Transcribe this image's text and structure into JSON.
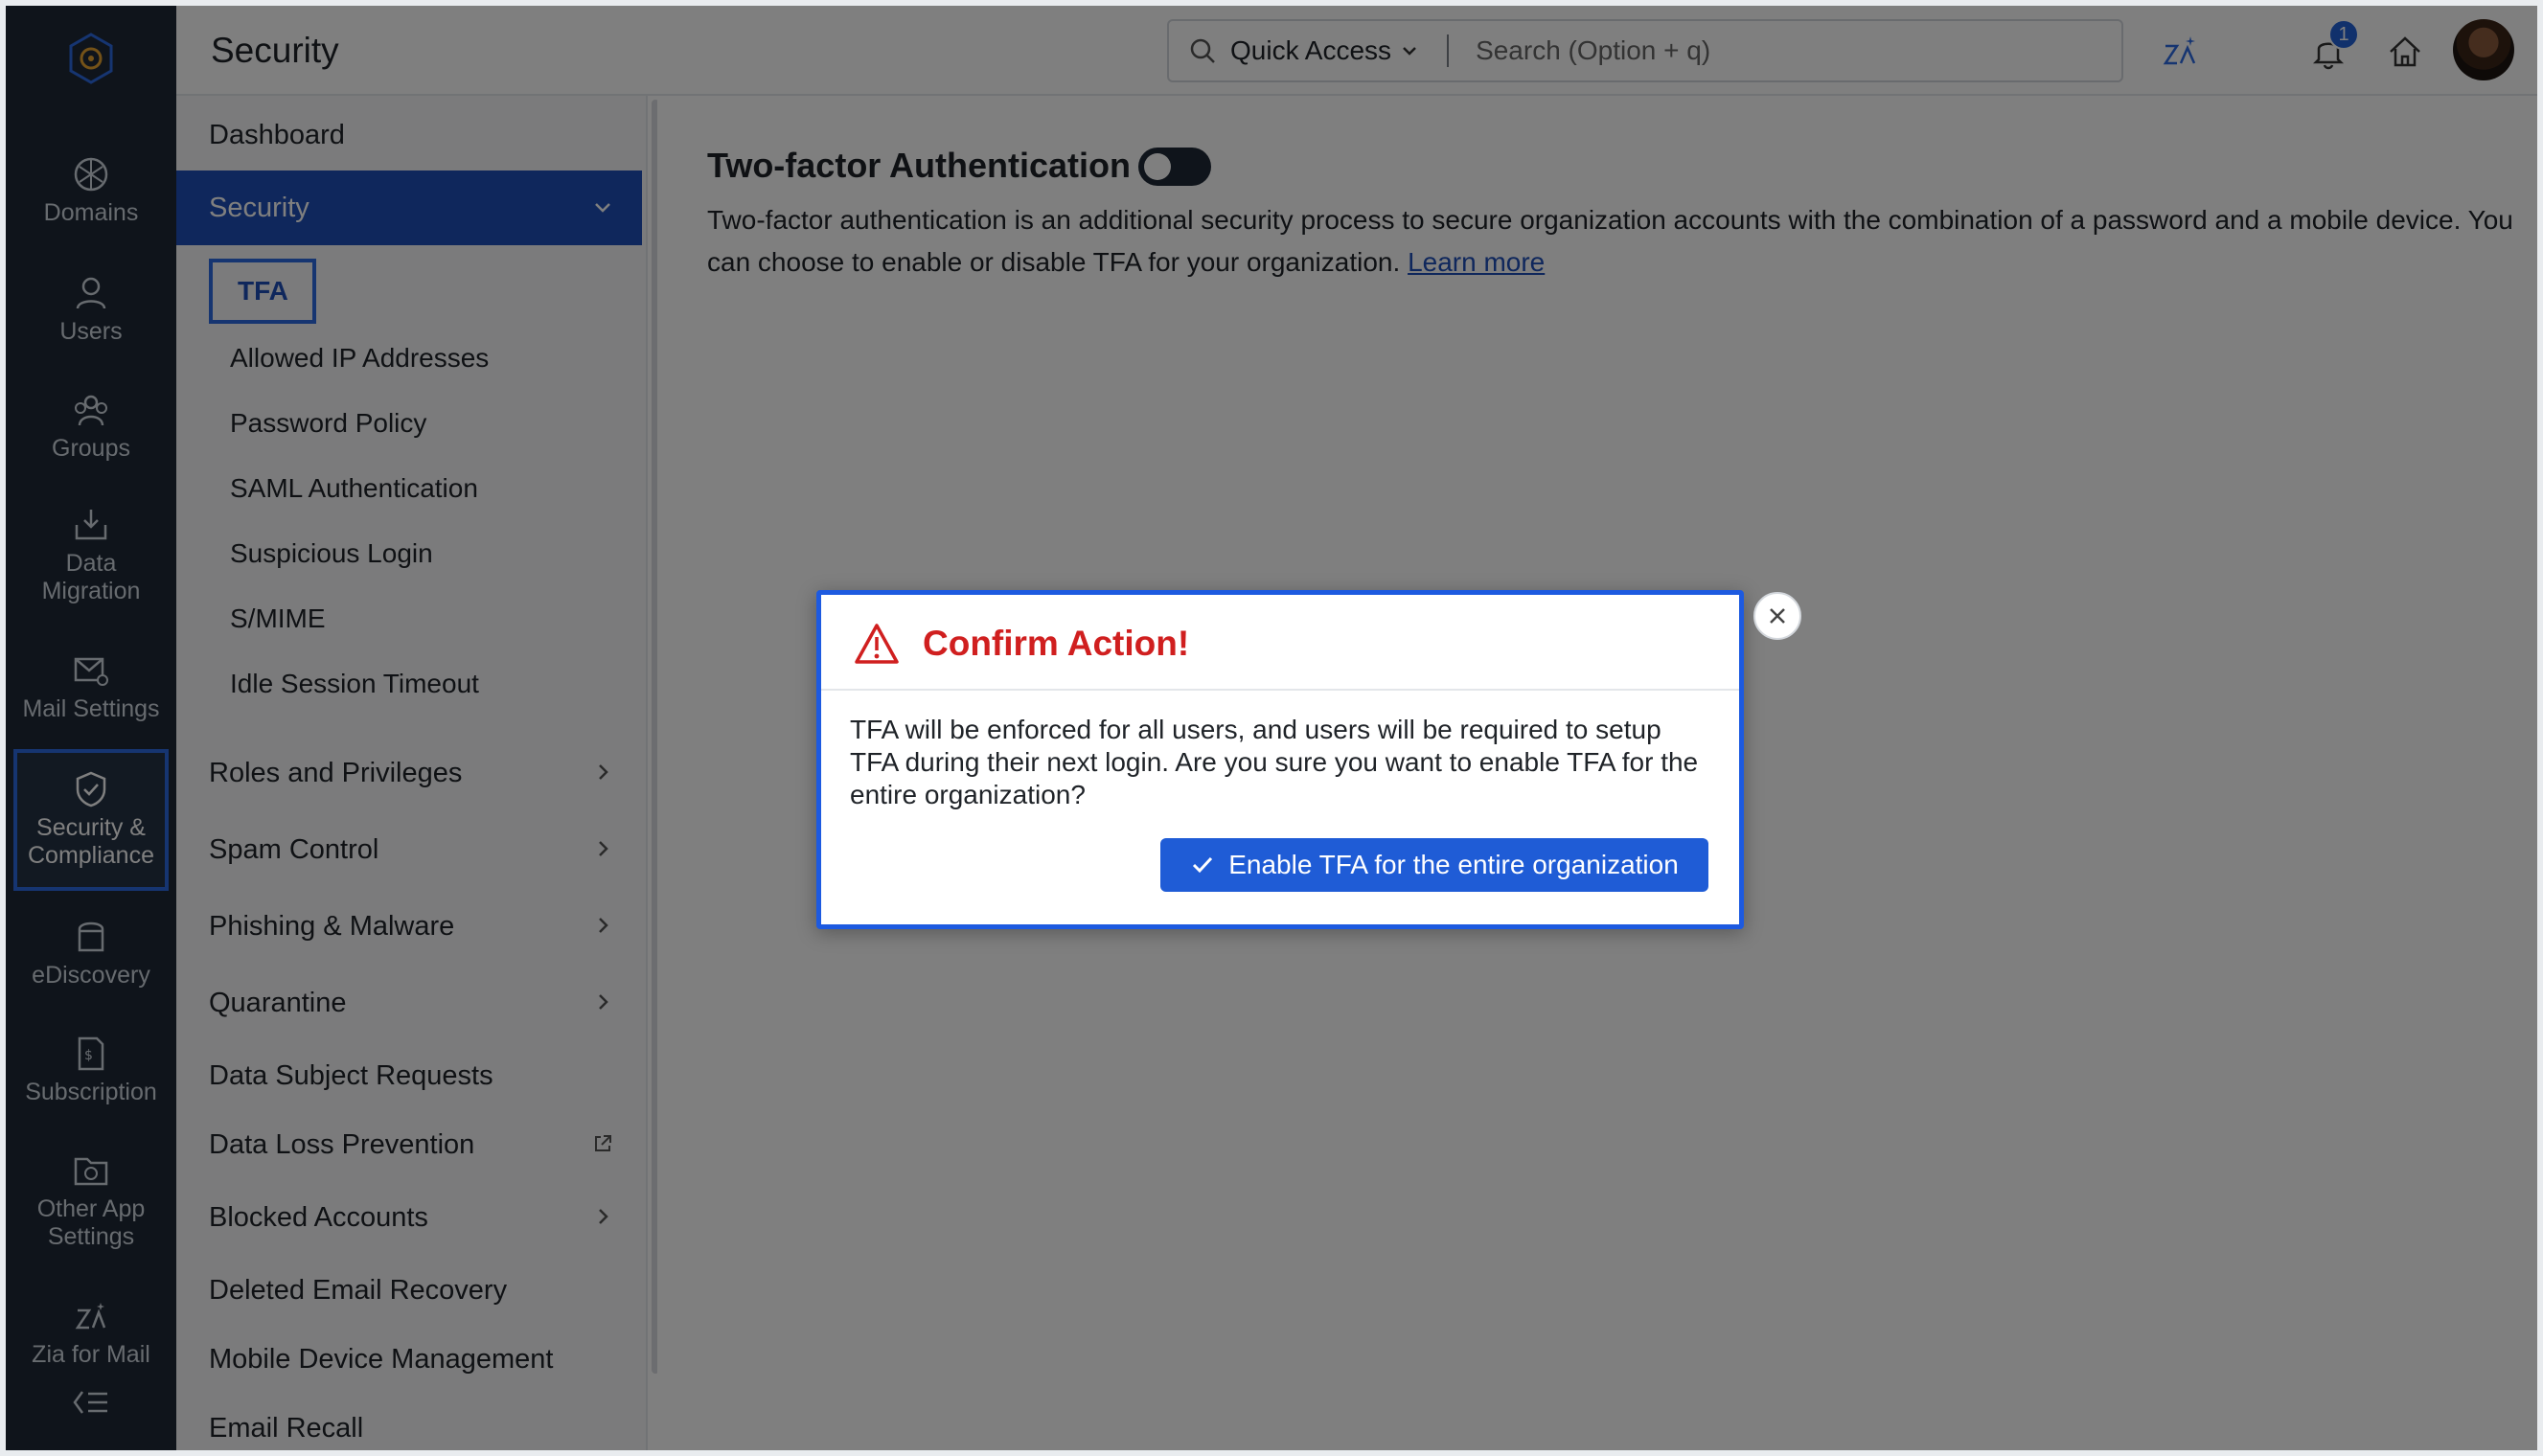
{
  "header": {
    "title": "Security",
    "quick_access_label": "Quick Access",
    "search_placeholder": "Search (Option + q)",
    "notification_count": "1"
  },
  "rail": {
    "items": [
      {
        "label": "Domains"
      },
      {
        "label": "Users"
      },
      {
        "label": "Groups"
      },
      {
        "label": "Data Migration"
      },
      {
        "label": "Mail Settings"
      },
      {
        "label": "Security & Compliance"
      },
      {
        "label": "eDiscovery"
      },
      {
        "label": "Subscription"
      },
      {
        "label": "Other App Settings"
      },
      {
        "label": "Zia for Mail"
      }
    ]
  },
  "subnav": {
    "dashboard": "Dashboard",
    "security": "Security",
    "security_children": [
      "TFA",
      "Allowed IP Addresses",
      "Password Policy",
      "SAML Authentication",
      "Suspicious Login",
      "S/MIME",
      "Idle Session Timeout"
    ],
    "items": [
      "Roles and Privileges",
      "Spam Control",
      "Phishing & Malware",
      "Quarantine",
      "Data Subject Requests",
      "Data Loss Prevention",
      "Blocked Accounts",
      "Deleted Email Recovery",
      "Mobile Device Management",
      "Email Recall"
    ]
  },
  "main": {
    "title": "Two-factor Authentication",
    "description": "Two-factor authentication is an additional security process to secure organization accounts with the combination of a password and a mobile device. You can choose to enable or disable TFA for your organization.",
    "learn_more": "Learn more"
  },
  "dialog": {
    "title": "Confirm Action!",
    "body": "TFA will be enforced for all users, and users will be required to setup TFA during their next login. Are you sure you want to enable TFA for the entire organization?",
    "confirm_label": "Enable TFA for the entire organization"
  },
  "colors": {
    "accent": "#1f5cd6",
    "danger": "#d01f1f",
    "rail_bg": "#1f2937"
  }
}
